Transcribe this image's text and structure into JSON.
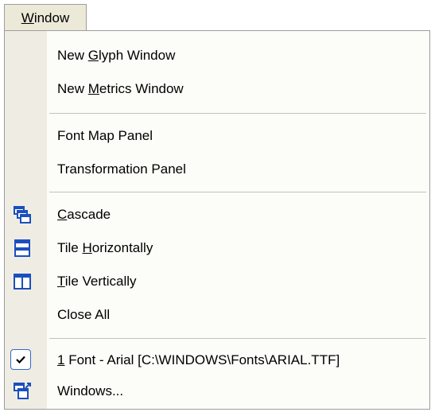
{
  "menu_title": {
    "mnemonic": "W",
    "rest": "indow"
  },
  "groups": {
    "new": [
      {
        "pre": "New ",
        "mn": "G",
        "post": "lyph Window"
      },
      {
        "pre": "New ",
        "mn": "M",
        "post": "etrics Window"
      }
    ],
    "panels": [
      {
        "label": "Font Map Panel"
      },
      {
        "label": "Transformation Panel"
      }
    ],
    "arrange": [
      {
        "pre": "",
        "mn": "C",
        "post": "ascade",
        "icon": "cascade-icon"
      },
      {
        "pre": "Tile ",
        "mn": "H",
        "post": "orizontally",
        "icon": "tile-horizontal-icon"
      },
      {
        "pre": "",
        "mn": "T",
        "post": "ile Vertically",
        "icon": "tile-vertical-icon"
      },
      {
        "pre": "",
        "mn": "",
        "post": "Close All",
        "icon": ""
      }
    ],
    "windows": [
      {
        "pre": "",
        "mn": "1",
        "post": " Font - Arial [C:\\WINDOWS\\Fonts\\ARIAL.TTF]",
        "checked": true
      },
      {
        "pre": "",
        "mn": "",
        "post": "Windows...",
        "icon": "windows-list-icon"
      }
    ]
  },
  "colors": {
    "icon_blue": "#1b4fbf",
    "gutter": "#efede3",
    "menu_bg": "#fcfcf9",
    "check_border": "#3169c6"
  }
}
